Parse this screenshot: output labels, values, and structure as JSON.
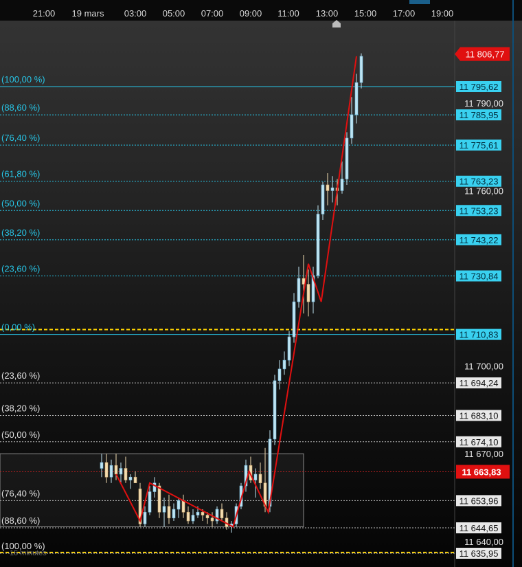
{
  "chart_data": {
    "type": "candlestick",
    "time_axis_labels": [
      "21:00",
      "19 mars",
      "03:00",
      "05:00",
      "07:00",
      "09:00",
      "11:00",
      "13:00",
      "15:00",
      "17:00",
      "19:00"
    ],
    "price_axis_labels": [
      11790,
      11760,
      11700,
      11670,
      11640
    ],
    "price_axis_label_text": [
      "11 790,00",
      "11 760,00",
      "11 700,00",
      "11 670,00",
      "11 640,00"
    ],
    "ylim": [
      11632,
      11812
    ],
    "last_price": {
      "value": 11806.77,
      "text": "11 806,77"
    },
    "current_price": {
      "value": 11663.83,
      "text": "11 663,83"
    },
    "fib_upper": {
      "levels": [
        {
          "pct": "(100,00 %)",
          "price": 11795.62,
          "text": "11 795,62",
          "dashed": false
        },
        {
          "pct": "(88,60 %)",
          "price": 11785.95,
          "text": "11 785,95",
          "dashed": true
        },
        {
          "pct": "(76,40 %)",
          "price": 11775.61,
          "text": "11 775,61",
          "dashed": true
        },
        {
          "pct": "(61,80 %)",
          "price": 11763.23,
          "text": "11 763,23",
          "dashed": true
        },
        {
          "pct": "(50,00 %)",
          "price": 11753.23,
          "text": "11 753,23",
          "dashed": true
        },
        {
          "pct": "(38,20 %)",
          "price": 11743.22,
          "text": "11 743,22",
          "dashed": true
        },
        {
          "pct": "(23,60 %)",
          "price": 11730.84,
          "text": "11 730,84",
          "dashed": true
        },
        {
          "pct": "(0,00 %)",
          "price": 11710.83,
          "text": "11 710,83",
          "dashed": false
        }
      ],
      "color": "#27c5e6"
    },
    "fib_lower": {
      "levels": [
        {
          "pct": "(23,60 %)",
          "price": 11694.24,
          "text": "11 694,24"
        },
        {
          "pct": "(38,20 %)",
          "price": 11683.1,
          "text": "11 683,10"
        },
        {
          "pct": "(50,00 %)",
          "price": 11674.1,
          "text": "11 674,10"
        },
        {
          "pct": "(76,40 %)",
          "price": 11653.96,
          "text": "11 653,96"
        },
        {
          "pct": "(88,60 %)",
          "price": 11644.65,
          "text": "11 644,65"
        },
        {
          "pct": "(100,00 %)",
          "price": 11635.95,
          "text": "11 635,95"
        }
      ],
      "color": "#d8d8d8"
    },
    "yellow_levels": [
      11712.5,
      11636.2
    ],
    "timeframe_label": "15 minutes",
    "zigzag": [
      {
        "t": "00:45",
        "p": 11663
      },
      {
        "t": "02:00",
        "p": 11647
      },
      {
        "t": "02:30",
        "p": 11660
      },
      {
        "t": "06:50",
        "p": 11645
      },
      {
        "t": "07:40",
        "p": 11664
      },
      {
        "t": "08:40",
        "p": 11650
      },
      {
        "t": "10:45",
        "p": 11735
      },
      {
        "t": "11:25",
        "p": 11722
      },
      {
        "t": "13:15",
        "p": 11806
      }
    ],
    "candles": [
      {
        "t": "00:00",
        "o": 11665,
        "h": 11670,
        "l": 11662,
        "c": 11667
      },
      {
        "t": "00:15",
        "o": 11667,
        "h": 11670,
        "l": 11660,
        "c": 11662
      },
      {
        "t": "00:30",
        "o": 11662,
        "h": 11668,
        "l": 11660,
        "c": 11666
      },
      {
        "t": "00:45",
        "o": 11666,
        "h": 11670,
        "l": 11661,
        "c": 11663
      },
      {
        "t": "01:00",
        "o": 11663,
        "h": 11667,
        "l": 11660,
        "c": 11665
      },
      {
        "t": "01:15",
        "o": 11665,
        "h": 11669,
        "l": 11660,
        "c": 11661
      },
      {
        "t": "01:30",
        "o": 11661,
        "h": 11663,
        "l": 11658,
        "c": 11662
      },
      {
        "t": "01:45",
        "o": 11662,
        "h": 11664,
        "l": 11660,
        "c": 11660
      },
      {
        "t": "02:00",
        "o": 11658,
        "h": 11660,
        "l": 11645,
        "c": 11646
      },
      {
        "t": "02:15",
        "o": 11646,
        "h": 11652,
        "l": 11645,
        "c": 11650
      },
      {
        "t": "02:30",
        "o": 11650,
        "h": 11659,
        "l": 11649,
        "c": 11657
      },
      {
        "t": "02:45",
        "o": 11657,
        "h": 11662,
        "l": 11655,
        "c": 11660
      },
      {
        "t": "03:00",
        "o": 11659,
        "h": 11660,
        "l": 11648,
        "c": 11650
      },
      {
        "t": "03:15",
        "o": 11650,
        "h": 11655,
        "l": 11645,
        "c": 11652
      },
      {
        "t": "03:30",
        "o": 11652,
        "h": 11656,
        "l": 11646,
        "c": 11648
      },
      {
        "t": "03:45",
        "o": 11648,
        "h": 11653,
        "l": 11647,
        "c": 11651
      },
      {
        "t": "04:00",
        "o": 11651,
        "h": 11655,
        "l": 11648,
        "c": 11654
      },
      {
        "t": "04:15",
        "o": 11654,
        "h": 11656,
        "l": 11648,
        "c": 11650
      },
      {
        "t": "04:30",
        "o": 11650,
        "h": 11652,
        "l": 11646,
        "c": 11647
      },
      {
        "t": "04:45",
        "o": 11647,
        "h": 11651,
        "l": 11646,
        "c": 11649
      },
      {
        "t": "05:00",
        "o": 11649,
        "h": 11652,
        "l": 11648,
        "c": 11650
      },
      {
        "t": "05:15",
        "o": 11650,
        "h": 11651,
        "l": 11647,
        "c": 11649
      },
      {
        "t": "05:30",
        "o": 11649,
        "h": 11650,
        "l": 11646,
        "c": 11648
      },
      {
        "t": "05:45",
        "o": 11648,
        "h": 11650,
        "l": 11645,
        "c": 11647
      },
      {
        "t": "06:00",
        "o": 11647,
        "h": 11652,
        "l": 11646,
        "c": 11651
      },
      {
        "t": "06:15",
        "o": 11651,
        "h": 11653,
        "l": 11647,
        "c": 11648
      },
      {
        "t": "06:30",
        "o": 11648,
        "h": 11650,
        "l": 11644,
        "c": 11645
      },
      {
        "t": "06:45",
        "o": 11645,
        "h": 11647,
        "l": 11643,
        "c": 11646
      },
      {
        "t": "07:00",
        "o": 11646,
        "h": 11653,
        "l": 11645,
        "c": 11652
      },
      {
        "t": "07:15",
        "o": 11652,
        "h": 11660,
        "l": 11651,
        "c": 11659
      },
      {
        "t": "07:30",
        "o": 11659,
        "h": 11668,
        "l": 11657,
        "c": 11666
      },
      {
        "t": "07:45",
        "o": 11666,
        "h": 11669,
        "l": 11660,
        "c": 11661
      },
      {
        "t": "08:00",
        "o": 11661,
        "h": 11665,
        "l": 11655,
        "c": 11663
      },
      {
        "t": "08:15",
        "o": 11663,
        "h": 11667,
        "l": 11658,
        "c": 11660
      },
      {
        "t": "08:30",
        "o": 11660,
        "h": 11672,
        "l": 11650,
        "c": 11652
      },
      {
        "t": "08:45",
        "o": 11652,
        "h": 11678,
        "l": 11650,
        "c": 11675
      },
      {
        "t": "09:00",
        "o": 11675,
        "h": 11697,
        "l": 11673,
        "c": 11695
      },
      {
        "t": "09:15",
        "o": 11695,
        "h": 11702,
        "l": 11692,
        "c": 11699
      },
      {
        "t": "09:30",
        "o": 11699,
        "h": 11705,
        "l": 11697,
        "c": 11702
      },
      {
        "t": "09:45",
        "o": 11702,
        "h": 11712,
        "l": 11700,
        "c": 11710
      },
      {
        "t": "10:00",
        "o": 11710,
        "h": 11725,
        "l": 11708,
        "c": 11722
      },
      {
        "t": "10:15",
        "o": 11722,
        "h": 11734,
        "l": 11720,
        "c": 11730
      },
      {
        "t": "10:30",
        "o": 11730,
        "h": 11738,
        "l": 11718,
        "c": 11728
      },
      {
        "t": "10:45",
        "o": 11728,
        "h": 11733,
        "l": 11717,
        "c": 11722
      },
      {
        "t": "11:00",
        "o": 11722,
        "h": 11734,
        "l": 11718,
        "c": 11731
      },
      {
        "t": "11:15",
        "o": 11731,
        "h": 11755,
        "l": 11730,
        "c": 11752
      },
      {
        "t": "11:30",
        "o": 11752,
        "h": 11763,
        "l": 11750,
        "c": 11762
      },
      {
        "t": "11:45",
        "o": 11762,
        "h": 11766,
        "l": 11755,
        "c": 11760
      },
      {
        "t": "12:00",
        "o": 11760,
        "h": 11765,
        "l": 11756,
        "c": 11761
      },
      {
        "t": "12:15",
        "o": 11761,
        "h": 11764,
        "l": 11755,
        "c": 11760
      },
      {
        "t": "12:30",
        "o": 11760,
        "h": 11770,
        "l": 11759,
        "c": 11764
      },
      {
        "t": "12:45",
        "o": 11764,
        "h": 11780,
        "l": 11762,
        "c": 11778
      },
      {
        "t": "13:00",
        "o": 11778,
        "h": 11792,
        "l": 11776,
        "c": 11786
      },
      {
        "t": "13:15",
        "o": 11786,
        "h": 11800,
        "l": 11783,
        "c": 11797
      },
      {
        "t": "13:30",
        "o": 11797,
        "h": 11807,
        "l": 11795,
        "c": 11806
      }
    ],
    "colors": {
      "up": "#bfe4f2",
      "down": "#f3ddb2",
      "zigzag": "#e01010",
      "price_tag": "#e01010",
      "fib": "#27c5e6",
      "neutral": "#dcdcdc",
      "yellow": "#ffd400"
    }
  }
}
